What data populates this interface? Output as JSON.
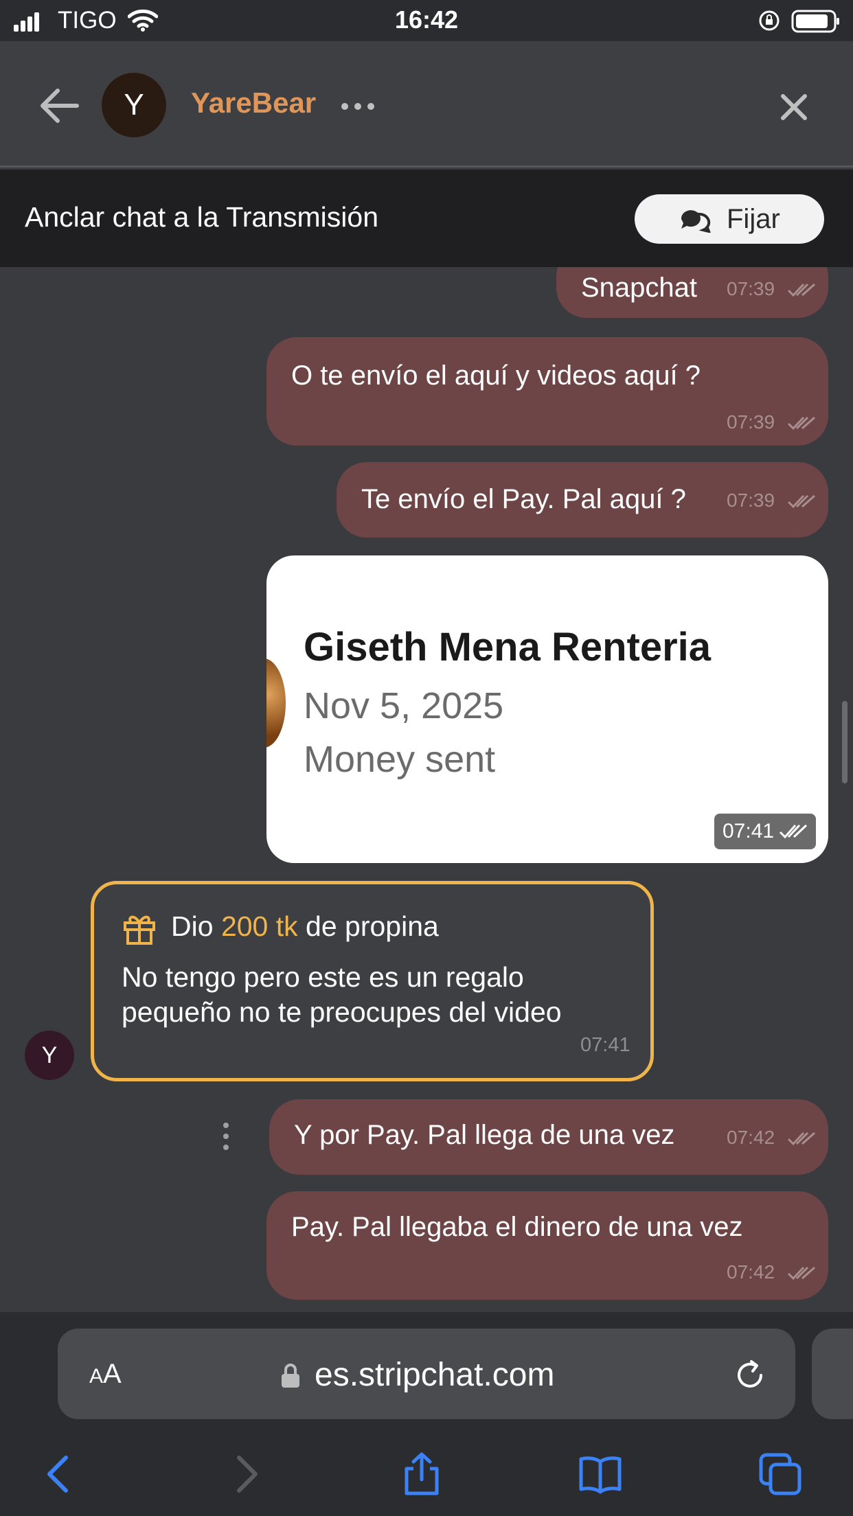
{
  "status_bar": {
    "carrier": "TIGO",
    "time": "16:42"
  },
  "header": {
    "avatar_initial": "Y",
    "username": "YareBear"
  },
  "pin_bar": {
    "text": "Anclar chat a la Transmisión",
    "button_label": "Fijar"
  },
  "messages": [
    {
      "text": "Snapchat",
      "time": "07:39"
    },
    {
      "text": "O te envío el aquí y videos aquí ?",
      "time": "07:39"
    },
    {
      "text": "Te envío el Pay. Pal aquí ?",
      "time": "07:39"
    },
    {
      "text": "Y por Pay. Pal llega de una vez",
      "time": "07:42"
    },
    {
      "text": "Pay. Pal llegaba el dinero de una vez",
      "time": "07:42"
    }
  ],
  "image_message": {
    "name": "Giseth Mena  Renteria",
    "date": "Nov 5, 2025",
    "status": "Money sent",
    "time": "07:41"
  },
  "tip_message": {
    "prefix": "Dio",
    "amount": "200 tk",
    "suffix": "de propina",
    "message": "No tengo pero este es un regalo pequeño no te preocupes del video",
    "time": "07:41",
    "avatar_initial": "Y"
  },
  "browser": {
    "text_size_label": "AA",
    "url": "es.stripchat.com"
  },
  "colors": {
    "accent_username": "#e09658",
    "tip_border": "#f0b44a",
    "outgoing_bubble": "#6e4547",
    "ios_blue": "#3b82f6"
  }
}
